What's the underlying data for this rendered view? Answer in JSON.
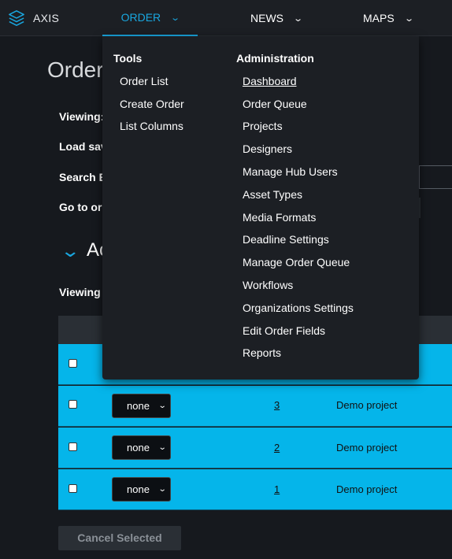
{
  "app": {
    "name": "AXIS"
  },
  "nav": {
    "order": "ORDER",
    "news": "NEWS",
    "maps": "MAPS"
  },
  "page": {
    "title": "Order",
    "labels": {
      "viewing": "Viewing:",
      "load_saved": "Load sav",
      "search_by": "Search B",
      "go_to_order": "Go to ord",
      "viewing2": "Viewing"
    },
    "section_title": "Ac",
    "rows": [
      {
        "select": "none",
        "number": "3",
        "project": "Demo project"
      },
      {
        "select": "none",
        "number": "2",
        "project": "Demo project"
      },
      {
        "select": "none",
        "number": "1",
        "project": "Demo project"
      }
    ],
    "cancel_selected": "Cancel Selected"
  },
  "dropdown": {
    "tools": {
      "heading": "Tools",
      "items": [
        "Order List",
        "Create Order",
        "List Columns"
      ]
    },
    "administration": {
      "heading": "Administration",
      "items": [
        "Dashboard",
        "Order Queue",
        "Projects",
        "Designers",
        "Manage Hub Users",
        "Asset Types",
        "Media Formats",
        "Deadline Settings",
        "Manage Order Queue",
        "Workflows",
        "Organizations Settings",
        "Edit Order Fields",
        "Reports"
      ]
    }
  },
  "colors": {
    "accent": "#19a7e0",
    "row_bg": "#05b5ea",
    "background": "#16191e",
    "menu_bg": "#1c1f24"
  },
  "icons": {
    "logo": "layers-icon",
    "chevron": "chevron-down-icon",
    "section": "chevron-down-icon"
  }
}
